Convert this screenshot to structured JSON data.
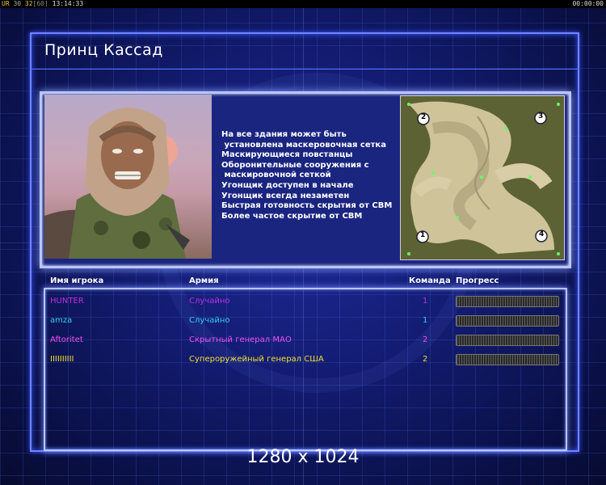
{
  "topbar": {
    "left_parts": [
      "UR",
      " 30 ",
      "32",
      "[60]",
      " 13:14:33"
    ],
    "right": "00:00:00"
  },
  "title": "Принц Кассад",
  "general_features": [
    "На все здания может быть",
    " установлена маскеровочная сетка",
    "Маскирующиеся повстанцы",
    "Оборонительные сооружения с",
    " маскировочной сеткой",
    "Угонщик доступен в начале",
    "Угонщик всегда незаметен",
    "Быстрая готовность скрытия от СВМ",
    "Более частое скрытие от СВМ"
  ],
  "map": {
    "start_positions": [
      "1",
      "2",
      "3",
      "4"
    ]
  },
  "players_table": {
    "headers": {
      "name": "Имя игрока",
      "army": "Армия",
      "team": "Команда",
      "progress": "Прогресс"
    },
    "rows": [
      {
        "name": "HUNTER",
        "army": "Случайно",
        "team": "1",
        "color": "#c030e0",
        "progress": 1.0
      },
      {
        "name": "amza",
        "army": "Случайно",
        "team": "1",
        "color": "#30d0e8",
        "progress": 1.0
      },
      {
        "name": "Aftoritet",
        "army": "Скрытный генерал МАО",
        "team": "2",
        "color": "#f050f0",
        "progress": 1.0
      },
      {
        "name": "IIIIIIIIII",
        "army": "Супероружейный генерал США",
        "team": "2",
        "color": "#f0e030",
        "progress": 1.0
      }
    ]
  },
  "watermark": "1280 x 1024"
}
